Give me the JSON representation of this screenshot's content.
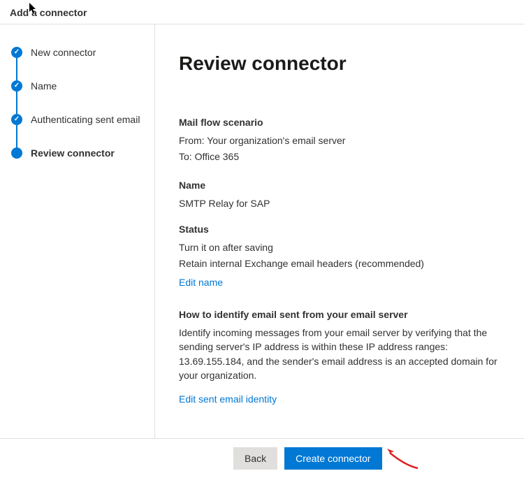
{
  "header": {
    "title": "Add a connector"
  },
  "sidebar": {
    "steps": [
      {
        "label": "New connector",
        "state": "done"
      },
      {
        "label": "Name",
        "state": "done"
      },
      {
        "label": "Authenticating sent email",
        "state": "done"
      },
      {
        "label": "Review connector",
        "state": "current"
      }
    ]
  },
  "main": {
    "heading": "Review connector",
    "mailflow": {
      "title": "Mail flow scenario",
      "from": "From: Your organization's email server",
      "to": "To: Office 365"
    },
    "name": {
      "title": "Name",
      "value": "SMTP Relay for SAP"
    },
    "status": {
      "title": "Status",
      "line1": "Turn it on after saving",
      "line2": "Retain internal Exchange email headers (recommended)",
      "edit_link": "Edit name"
    },
    "identify": {
      "title": "How to identify email sent from your email server",
      "body": "Identify incoming messages from your email server by verifying that the sending server's IP address is within these IP address ranges: 13.69.155.184, and the sender's email address is an accepted domain for your organization.",
      "edit_link": "Edit sent email identity"
    }
  },
  "footer": {
    "back_label": "Back",
    "create_label": "Create connector"
  }
}
